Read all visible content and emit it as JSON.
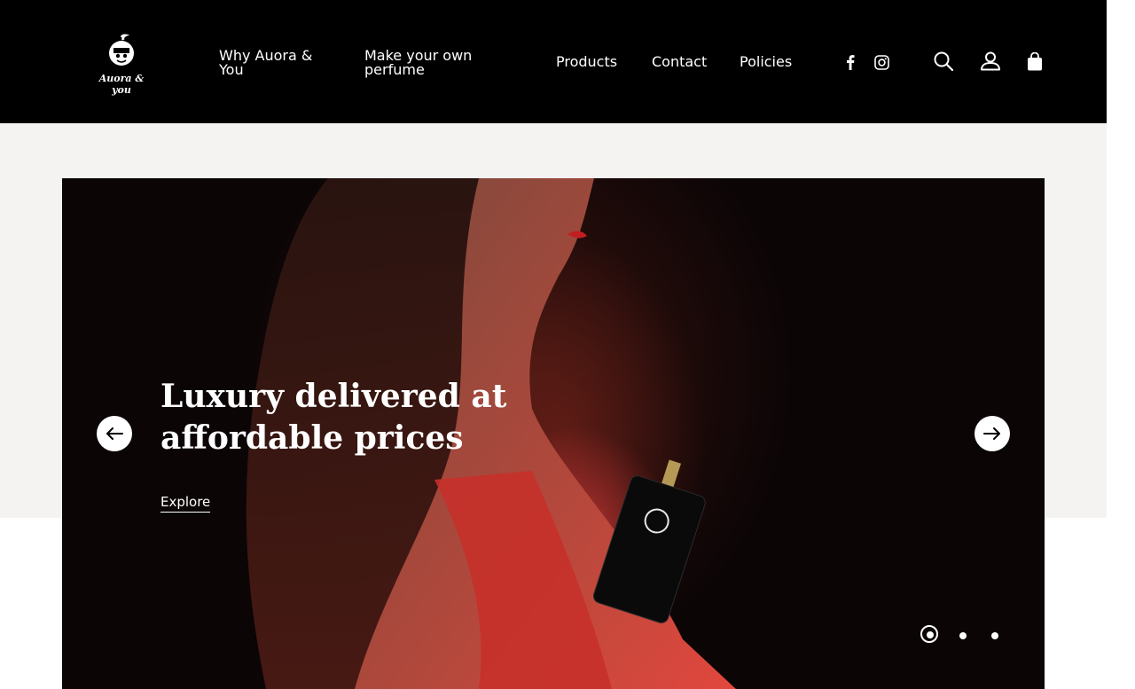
{
  "header": {
    "logo_text": "Auora & you",
    "nav": {
      "why": "Why Auora & You",
      "make": "Make your own perfume",
      "products": "Products",
      "contact": "Contact",
      "policies": "Policies"
    },
    "icons": [
      "facebook-icon",
      "instagram-icon",
      "search-icon",
      "account-icon",
      "shopping-bag-icon"
    ]
  },
  "hero": {
    "title": "Luxury delivered at affordable prices",
    "cta": "Explore",
    "slides_total": 3,
    "active_slide": 1
  },
  "colors": {
    "header_bg": "#000000",
    "page_bg": "#f4f3f1",
    "accent_red": "#d7302a"
  }
}
